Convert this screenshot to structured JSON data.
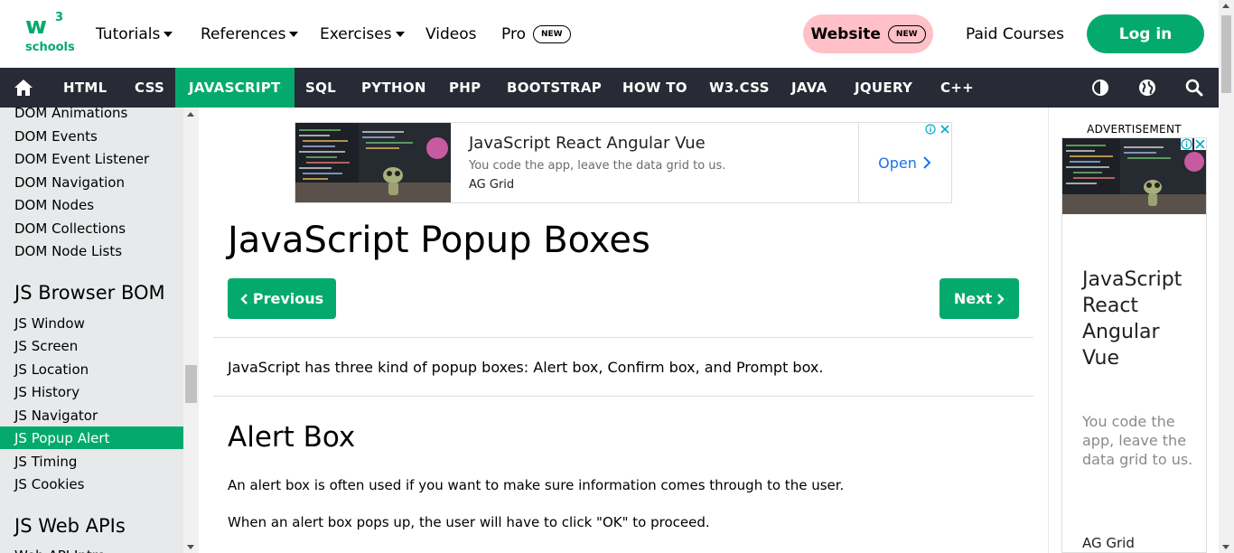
{
  "logo": {
    "main": "w",
    "sup": "3",
    "sub": "schools"
  },
  "topnav": {
    "tutorials": "Tutorials",
    "references": "References",
    "exercises": "Exercises",
    "videos": "Videos",
    "pro": "Pro",
    "pro_badge": "NEW",
    "website": "Website",
    "website_badge": "NEW",
    "paid_courses": "Paid Courses",
    "login": "Log in"
  },
  "darknav": {
    "items": [
      "HTML",
      "CSS",
      "JAVASCRIPT",
      "SQL",
      "PYTHON",
      "PHP",
      "BOOTSTRAP",
      "HOW TO",
      "W3.CSS",
      "JAVA",
      "JQUERY",
      "C++"
    ],
    "active": "JAVASCRIPT",
    "icons": [
      "home-icon",
      "contrast-icon",
      "globe-icon",
      "search-icon"
    ]
  },
  "sidebar": {
    "dom_links": [
      "DOM Animations",
      "DOM Events",
      "DOM Event Listener",
      "DOM Navigation",
      "DOM Nodes",
      "DOM Collections",
      "DOM Node Lists"
    ],
    "bom_heading": "JS Browser BOM",
    "bom_links": [
      "JS Window",
      "JS Screen",
      "JS Location",
      "JS History",
      "JS Navigator",
      "JS Popup Alert",
      "JS Timing",
      "JS Cookies"
    ],
    "active": "JS Popup Alert",
    "webapi_heading": "JS Web APIs",
    "webapi_partial": "Web API Intro"
  },
  "ad_banner": {
    "title": "JavaScript React Angular Vue",
    "desc": "You code the app, leave the data grid to us.",
    "brand": "AG Grid",
    "cta": "Open",
    "info_icon": "info-icon",
    "close_icon": "close-icon"
  },
  "main": {
    "title": "JavaScript Popup Boxes",
    "prev": "Previous",
    "next": "Next",
    "intro": "JavaScript has three kind of popup boxes: Alert box, Confirm box, and Prompt box.",
    "alert_heading": "Alert Box",
    "alert_p1": "An alert box is often used if you want to make sure information comes through to the user.",
    "alert_p2": "When an alert box pops up, the user will have to click \"OK\" to proceed."
  },
  "right_ad": {
    "label": "ADVERTISEMENT",
    "title": "JavaScript React Angular Vue",
    "desc": "You code the app, leave the data grid to us.",
    "brand": "AG Grid"
  },
  "colors": {
    "brand_green": "#04AA6D",
    "dark_nav": "#282A35",
    "sidebar_bg": "#E7E9EB",
    "website_pill": "#FFC0C7"
  }
}
